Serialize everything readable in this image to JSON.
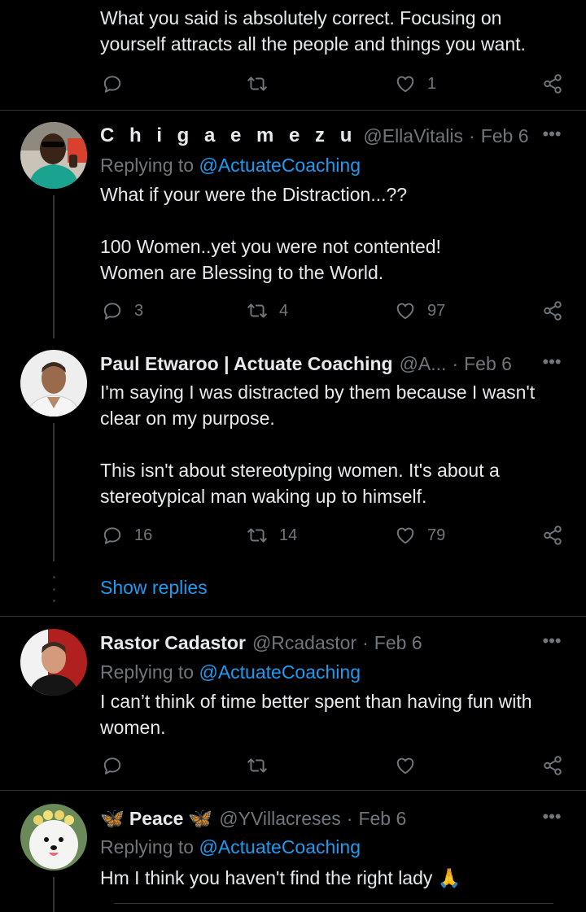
{
  "tweets": [
    {
      "text": "What you said is absolutely correct. Focusing on\nyourself attracts all the people and things you want.",
      "reply_count": "",
      "retweet_count": "",
      "like_count": "1"
    },
    {
      "name": "C h i g a e m e z u",
      "handle": "@EllaVitalis",
      "date": "Feb 6",
      "replying_prefix": "Replying to",
      "replying_mention": "@ActuateCoaching",
      "text": "What if your were the Distraction...??\n\n100 Women..yet you were not contented!\nWomen are Blessing to the World.",
      "reply_count": "3",
      "retweet_count": "4",
      "like_count": "97"
    },
    {
      "name": "Paul Etwaroo | Actuate Coaching",
      "handle": "@A...",
      "date": "Feb 6",
      "text": "I'm saying I was distracted by them because I wasn't\nclear on my purpose.\n\nThis isn't about stereotyping women. It's about a\nstereotypical man waking up to himself.",
      "reply_count": "16",
      "retweet_count": "14",
      "like_count": "79",
      "show_replies": "Show replies"
    },
    {
      "name": "Rastor Cadastor",
      "handle": "@Rcadastor",
      "date": "Feb 6",
      "replying_prefix": "Replying to",
      "replying_mention": "@ActuateCoaching",
      "text": "I can’t think of time better spent than having fun with\nwomen.",
      "reply_count": "",
      "retweet_count": "",
      "like_count": ""
    },
    {
      "name_prefix_emoji": "🦋",
      "name": "Peace",
      "name_suffix_emoji": "🦋",
      "handle": "@YVillacreses",
      "date": "Feb 6",
      "replying_prefix": "Replying to",
      "replying_mention": "@ActuateCoaching",
      "text": "Hm I think you haven't find the right lady 🙏"
    }
  ],
  "separator": "·",
  "more_glyph": "•••",
  "icons": [
    "reply-icon",
    "retweet-icon",
    "like-icon",
    "share-icon",
    "more-icon"
  ],
  "colors": {
    "background": "#000000",
    "text": "#e7e9ea",
    "muted": "#71767b",
    "link": "#1d9bf0",
    "divider": "#2f3336"
  }
}
